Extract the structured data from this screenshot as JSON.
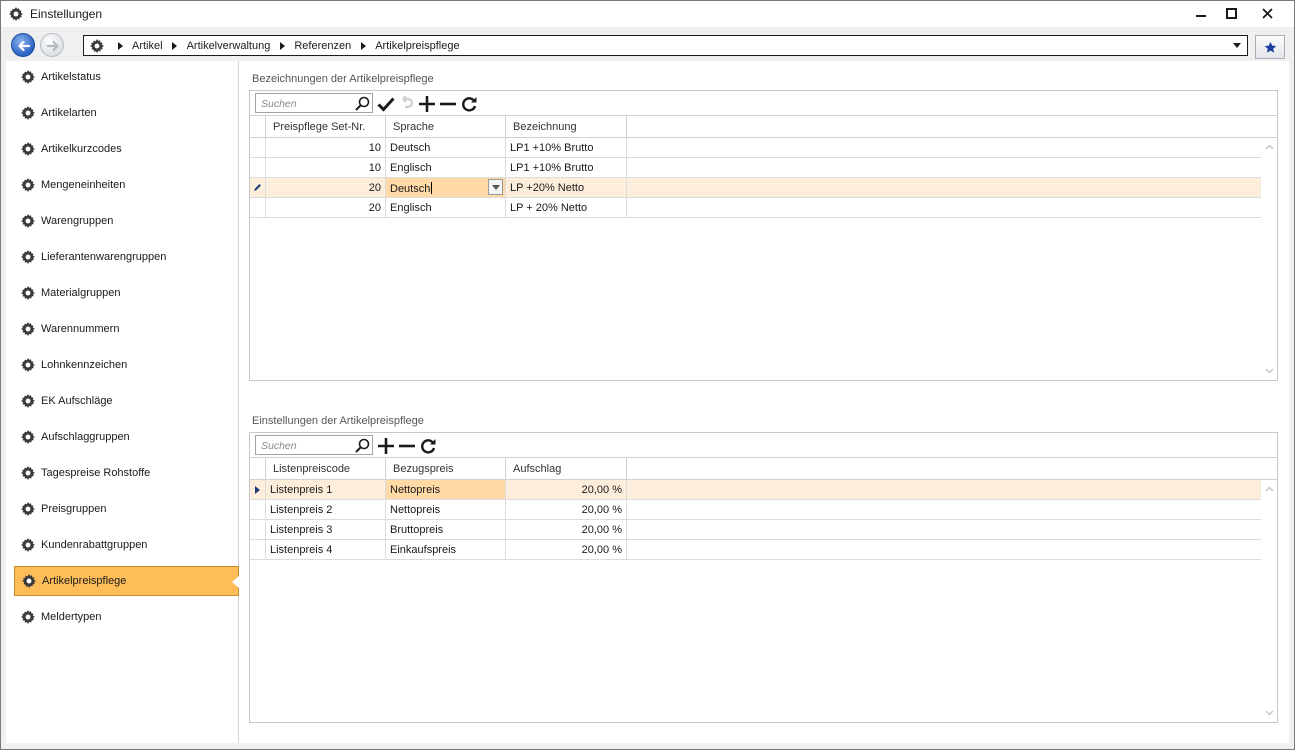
{
  "window": {
    "title": "Einstellungen",
    "icon": "gear-icon",
    "buttons": [
      "minimize-icon",
      "maximize-icon",
      "close-icon"
    ]
  },
  "navigation": {
    "breadcrumb": [
      "Artikel",
      "Artikelverwaltung",
      "Referenzen",
      "Artikelpreispflege"
    ],
    "favorite_icon": "star-icon"
  },
  "sidebar": {
    "items": [
      {
        "label": "Artikelstatus"
      },
      {
        "label": "Artikelarten"
      },
      {
        "label": "Artikelkurzcodes"
      },
      {
        "label": "Mengeneinheiten"
      },
      {
        "label": "Warengruppen"
      },
      {
        "label": "Lieferantenwarengruppen"
      },
      {
        "label": "Materialgruppen"
      },
      {
        "label": "Warennummern"
      },
      {
        "label": "Lohnkennzeichen"
      },
      {
        "label": "EK Aufschläge"
      },
      {
        "label": "Aufschlaggruppen"
      },
      {
        "label": "Tagespreise Rohstoffe"
      },
      {
        "label": "Preisgruppen"
      },
      {
        "label": "Kundenrabattgruppen"
      },
      {
        "label": "Artikelpreispflege"
      },
      {
        "label": "Meldertypen"
      }
    ],
    "active_index": 14,
    "active_color": "#ffbd5a"
  },
  "section1": {
    "title": "Bezeichnungen der Artikelpreispflege",
    "search_placeholder": "Suchen",
    "columns": [
      "Preispflege Set-Nr.",
      "Sprache",
      "Bezeichnung"
    ],
    "rows": [
      {
        "set_nr": "10",
        "sprache": "Deutsch",
        "bezeichnung": "LP1 +10% Brutto"
      },
      {
        "set_nr": "10",
        "sprache": "Englisch",
        "bezeichnung": "LP1 +10% Brutto"
      },
      {
        "set_nr": "20",
        "sprache": "Deutsch",
        "bezeichnung": "LP +20% Netto"
      },
      {
        "set_nr": "20",
        "sprache": "Englisch",
        "bezeichnung": "LP + 20% Netto"
      }
    ],
    "editing_row": 2
  },
  "section2": {
    "title": "Einstellungen der Artikelpreispflege",
    "search_placeholder": "Suchen",
    "columns": [
      "Listenpreiscode",
      "Bezugspreis",
      "Aufschlag"
    ],
    "rows": [
      {
        "code": "Listenpreis 1",
        "bezugspreis": "Nettopreis",
        "aufschlag": "20,00 %"
      },
      {
        "code": "Listenpreis 2",
        "bezugspreis": "Nettopreis",
        "aufschlag": "20,00 %"
      },
      {
        "code": "Listenpreis 3",
        "bezugspreis": "Bruttopreis",
        "aufschlag": "20,00 %"
      },
      {
        "code": "Listenpreis 4",
        "bezugspreis": "Einkaufspreis",
        "aufschlag": "20,00 %"
      }
    ],
    "focused_row": 0
  }
}
